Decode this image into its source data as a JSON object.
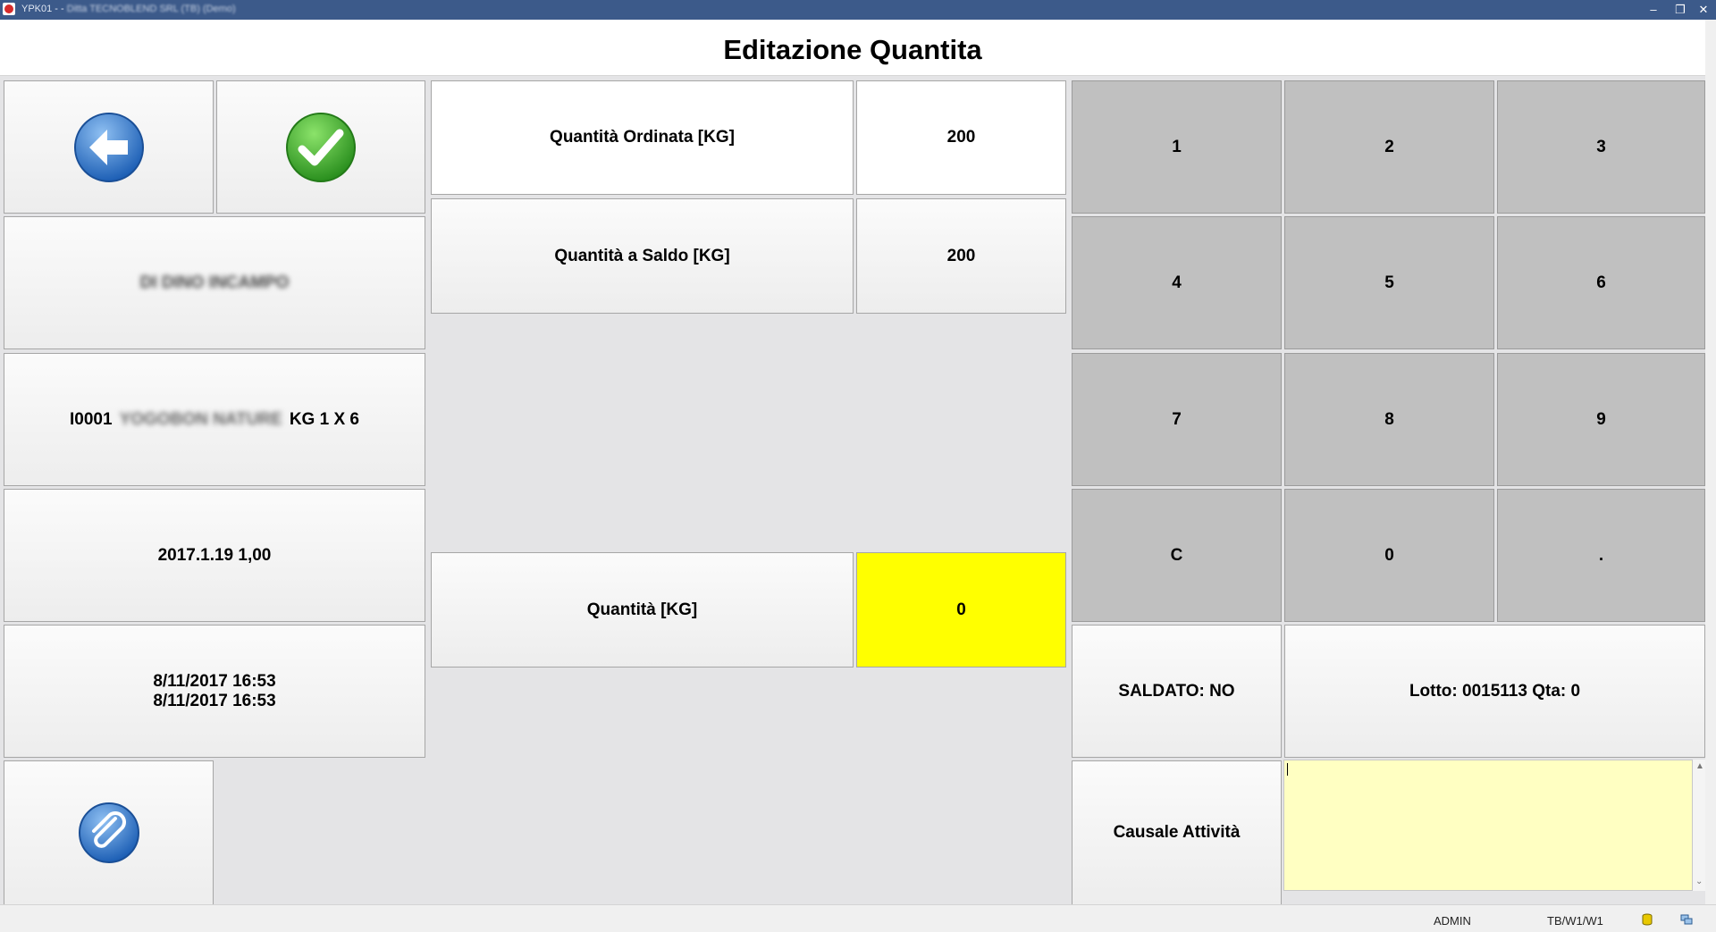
{
  "window": {
    "title_prefix": "YPK01 - -",
    "title_rest": "Ditta TECNOBLEND SRL (TB) (Demo)",
    "minimize": "–",
    "restore": "❐",
    "close": "✕"
  },
  "page_title": "Editazione Quantita",
  "left": {
    "customer": "DI DINO INCAMPO",
    "article_code": "I0001",
    "article_desc": "YOGOBON NATURE",
    "article_pack": "KG 1 X 6",
    "lot_info": "2017.1.19 1,00",
    "date_line1": "8/11/2017 16:53",
    "date_line2": "8/11/2017 16:53"
  },
  "quantities": {
    "ordered_label": "Quantità Ordinata [KG]",
    "ordered_value": "200",
    "balance_label": "Quantità a Saldo [KG]",
    "balance_value": "200",
    "qty_label": "Quantità [KG]",
    "qty_value": "0"
  },
  "keypad": [
    "1",
    "2",
    "3",
    "4",
    "5",
    "6",
    "7",
    "8",
    "9",
    "C",
    "0",
    "."
  ],
  "status": {
    "saldato": "SALDATO: NO",
    "lotto": "Lotto: 0015113 Qta: 0",
    "causale_label": "Causale Attività"
  },
  "statusbar": {
    "user": "ADMIN",
    "path": "TB/W1/W1"
  },
  "colors": {
    "titlebar": "#3c5a8a",
    "keypad_bg": "#c0c0c0",
    "qty_highlight": "#ffff00",
    "notes_bg": "#ffffc2"
  },
  "icons": {
    "back": "back-arrow-icon",
    "confirm": "checkmark-icon",
    "attach": "paperclip-icon"
  }
}
